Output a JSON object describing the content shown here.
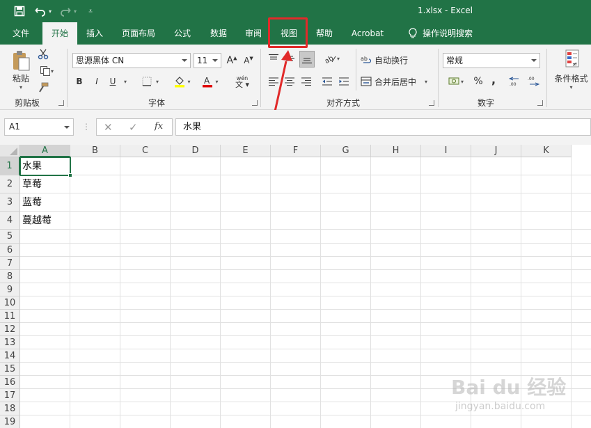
{
  "app": {
    "title": "1.xlsx  -  Excel",
    "theme_color": "#217346",
    "highlight_color": "#e12a2a"
  },
  "tabs": [
    "文件",
    "开始",
    "插入",
    "页面布局",
    "公式",
    "数据",
    "审阅",
    "视图",
    "帮助",
    "Acrobat",
    "操作说明搜索"
  ],
  "ribbon": {
    "clipboard": {
      "paste_label": "粘贴",
      "group_label": "剪贴板"
    },
    "font": {
      "font_name": "思源黑体 CN",
      "font_size": "11",
      "bold": "B",
      "italic": "I",
      "underline": "U",
      "phonetic": "wén",
      "group_label": "字体"
    },
    "alignment": {
      "wrap_text": "自动换行",
      "merge_center": "合并后居中",
      "group_label": "对齐方式"
    },
    "number": {
      "format": "常规",
      "percent": "%",
      "comma": ",",
      "group_label": "数字"
    },
    "styles": {
      "conditional_format": "条件格式"
    }
  },
  "formula_bar": {
    "name_box": "A1",
    "fx": "fx",
    "content": "水果"
  },
  "sheet": {
    "columns": [
      "A",
      "B",
      "C",
      "D",
      "E",
      "F",
      "G",
      "H",
      "I",
      "J",
      "K"
    ],
    "rows": [
      "1",
      "2",
      "3",
      "4",
      "5",
      "6",
      "7",
      "8",
      "9",
      "10",
      "11",
      "12",
      "13",
      "14",
      "15",
      "16",
      "17",
      "18",
      "19"
    ],
    "cells_A": [
      "水果",
      "草莓",
      "蓝莓",
      "蔓越莓"
    ]
  },
  "watermark": {
    "brand": "Bai du 经验",
    "url": "jingyan.baidu.com"
  }
}
